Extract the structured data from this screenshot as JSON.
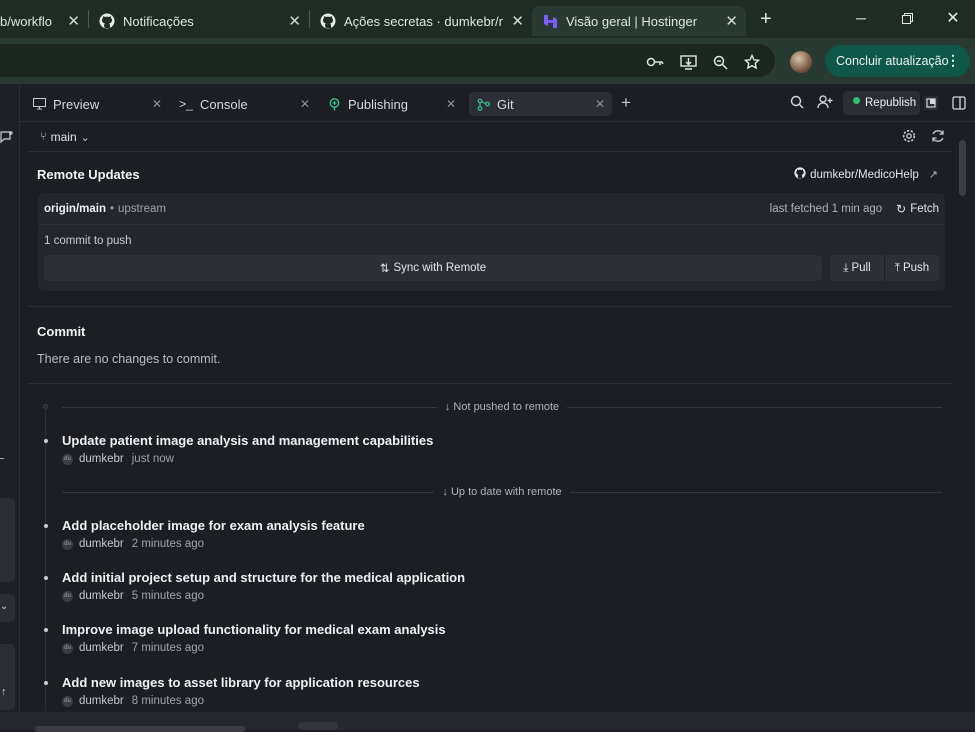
{
  "browser": {
    "tabs": [
      {
        "title": "b/workflo",
        "icon": "github-icon"
      },
      {
        "title": "Notificações",
        "icon": "github-icon"
      },
      {
        "title": "Ações secretas · dumkebr/m",
        "icon": "github-icon"
      },
      {
        "title": "Visão geral | Hostinger",
        "icon": "hostinger-icon",
        "active": true
      }
    ],
    "update_button": "Concluir atualização"
  },
  "panel_tabs": [
    {
      "label": "Preview",
      "icon": "monitor-icon"
    },
    {
      "label": "Console",
      "icon": "terminal-icon"
    },
    {
      "label": "Publishing",
      "icon": "publishing-icon"
    },
    {
      "label": "Git",
      "icon": "git-icon",
      "active": true
    }
  ],
  "toolbar": {
    "republish_label": "Republish"
  },
  "git": {
    "branch": "main",
    "remote_title": "Remote Updates",
    "repo": "dumkebr/MedicoHelp",
    "remote_branch": "origin/main",
    "upstream_label": "upstream",
    "last_fetched": "last fetched 1 min ago",
    "fetch_label": "Fetch",
    "commits_to_push": "1 commit to push",
    "sync_label": "Sync with Remote",
    "pull_label": "Pull",
    "push_label": "Push",
    "commit_title": "Commit",
    "no_changes": "There are no changes to commit.",
    "not_pushed_label": "Not pushed to remote",
    "up_to_date_label": "Up to date with remote",
    "unpushed_commits": [
      {
        "message": "Update patient image analysis and management capabilities",
        "author": "dumkebr",
        "time": "just now"
      }
    ],
    "pushed_commits": [
      {
        "message": "Add placeholder image for exam analysis feature",
        "author": "dumkebr",
        "time": "2 minutes ago"
      },
      {
        "message": "Add initial project setup and structure for the medical application",
        "author": "dumkebr",
        "time": "5 minutes ago"
      },
      {
        "message": "Improve image upload functionality for medical exam analysis",
        "author": "dumkebr",
        "time": "7 minutes ago"
      },
      {
        "message": "Add new images to asset library for application resources",
        "author": "dumkebr",
        "time": "8 minutes ago"
      }
    ]
  }
}
